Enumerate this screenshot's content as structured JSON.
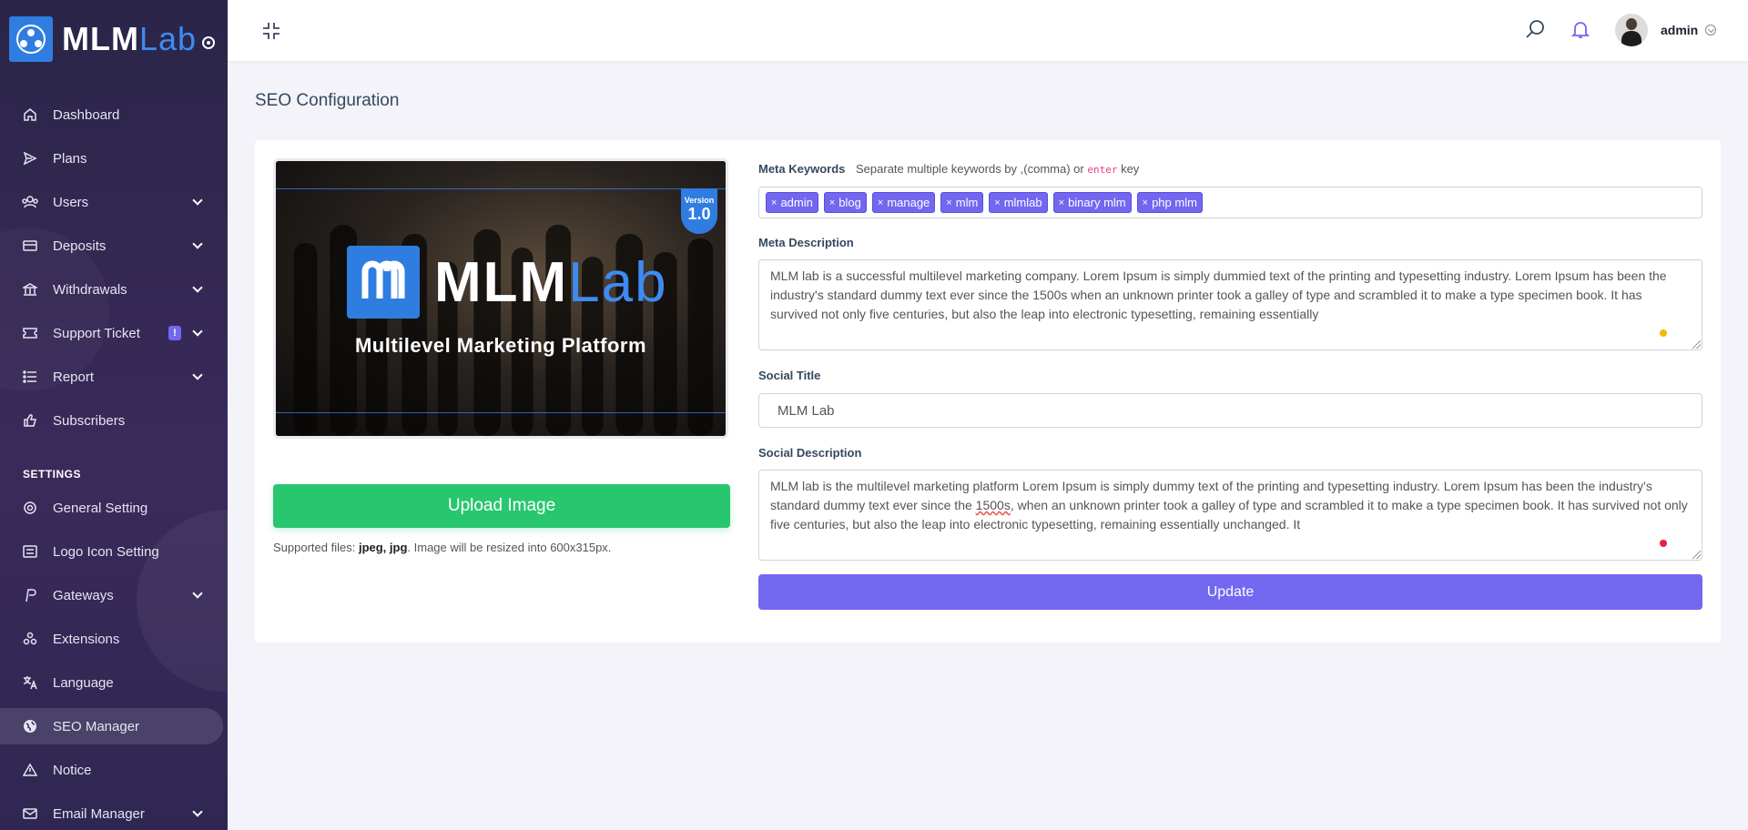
{
  "brand": {
    "name_main": "MLM",
    "name_accent": "Lab"
  },
  "sidebar": {
    "items": [
      {
        "label": "Dashboard",
        "icon": "home-icon"
      },
      {
        "label": "Plans",
        "icon": "send-icon"
      },
      {
        "label": "Users",
        "icon": "users-icon",
        "caret": true
      },
      {
        "label": "Deposits",
        "icon": "credit-card-icon",
        "caret": true
      },
      {
        "label": "Withdrawals",
        "icon": "bank-icon",
        "caret": true
      },
      {
        "label": "Support Ticket",
        "icon": "ticket-icon",
        "caret": true,
        "badge": "!"
      },
      {
        "label": "Report",
        "icon": "list-icon",
        "caret": true
      },
      {
        "label": "Subscribers",
        "icon": "thumbs-up-icon"
      }
    ],
    "settings_heading": "SETTINGS",
    "settings_items": [
      {
        "label": "General Setting",
        "icon": "life-ring-icon"
      },
      {
        "label": "Logo Icon Setting",
        "icon": "image-icon"
      },
      {
        "label": "Gateways",
        "icon": "paypal-icon",
        "caret": true
      },
      {
        "label": "Extensions",
        "icon": "cogs-icon"
      },
      {
        "label": "Language",
        "icon": "language-icon"
      },
      {
        "label": "SEO Manager",
        "icon": "globe-icon",
        "active": true
      },
      {
        "label": "Notice",
        "icon": "warning-icon"
      },
      {
        "label": "Email Manager",
        "icon": "envelope-icon",
        "caret": true
      }
    ]
  },
  "topbar": {
    "username": "admin"
  },
  "page": {
    "title": "SEO Configuration"
  },
  "preview": {
    "version_label": "Version",
    "version_number": "1.0",
    "logo_main": "MLM",
    "logo_accent": "Lab",
    "subtitle": "Multilevel Marketing Platform"
  },
  "upload": {
    "button_label": "Upload Image",
    "supported_prefix": "Supported files: ",
    "supported_types": "jpeg, jpg",
    "supported_suffix": ". Image will be resized into 600x315px."
  },
  "form": {
    "meta_keywords_label": "Meta Keywords",
    "meta_keywords_hint_a": "Separate multiple keywords by ,(comma) or",
    "meta_keywords_hint_code": "enter",
    "meta_keywords_hint_b": "key",
    "keywords": [
      "admin",
      "blog",
      "manage",
      "mlm",
      "mlmlab",
      "binary mlm",
      "php mlm"
    ],
    "meta_description_label": "Meta Description",
    "meta_description": "MLM lab is a successful multilevel marketing company. Lorem Ipsum is simply dummied text of the printing and typesetting industry. Lorem Ipsum has been the industry's standard dummy text ever since the 1500s when an unknown printer took a galley of type and scrambled it to make a type specimen book. It has survived not only five centuries, but also the leap into electronic typesetting, remaining essentially",
    "social_title_label": "Social Title",
    "social_title": "MLM Lab",
    "social_description_label": "Social Description",
    "social_description_a": "MLM lab is the multilevel marketing platform Lorem Ipsum is simply dummy text of the printing and typesetting industry. Lorem Ipsum has been the industry's standard dummy text ever since the ",
    "social_description_mark": "1500s",
    "social_description_b": ", when an unknown printer took a galley of type and scrambled it to make a type specimen book. It has survived not only five centuries, but also the leap into electronic typesetting, remaining essentially unchanged. It",
    "update_label": "Update"
  },
  "colors": {
    "primary": "#7367f0",
    "success": "#28c76f",
    "brand_blue": "#2f7de1",
    "sidebar_bg": "#2a2548"
  }
}
